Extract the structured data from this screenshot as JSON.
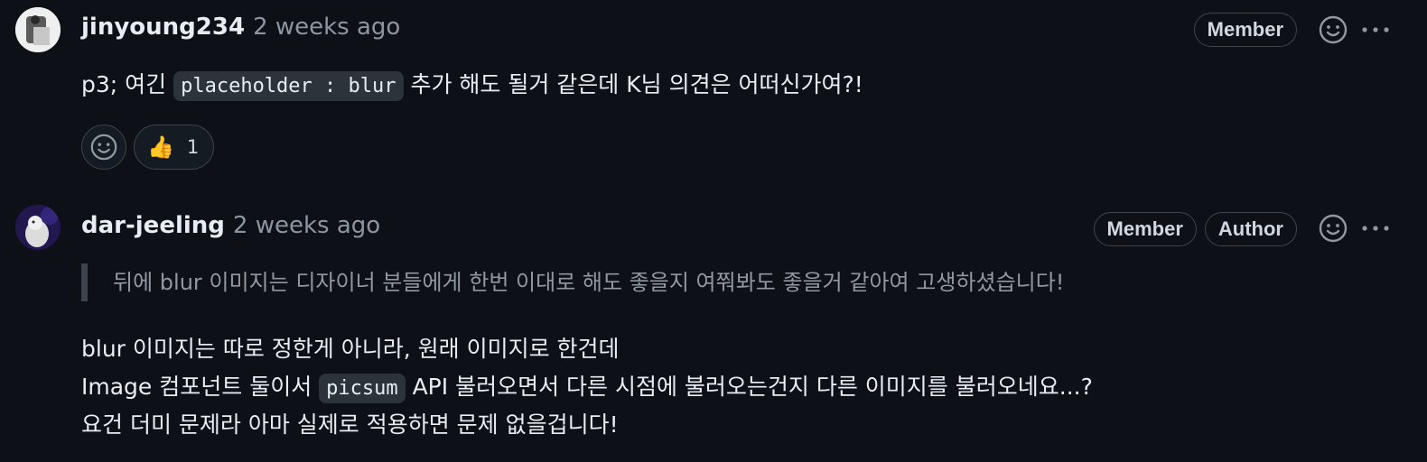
{
  "comments": [
    {
      "username": "jinyoung234",
      "timestamp": "2 weeks ago",
      "badges": [
        "Member"
      ],
      "body_prefix": "p3; 여긴 ",
      "body_code": "placeholder : blur",
      "body_suffix": " 추가 해도 될거 같은데 K님 의견은 어떠신가여?!",
      "reactions": [
        {
          "emoji": "👍",
          "count": "1"
        }
      ]
    },
    {
      "username": "dar-jeeling",
      "timestamp": "2 weeks ago",
      "badges": [
        "Member",
        "Author"
      ],
      "quote": "뒤에 blur 이미지는 디자이너 분들에게 한번 이대로 해도 좋을지 여쭤봐도 좋을거 같아여 고생하셨습니다!",
      "line1": "blur 이미지는 따로 정한게 아니라, 원래 이미지로 한건데",
      "line2_prefix": "Image 컴포넌트 둘이서 ",
      "line2_code": "picsum",
      "line2_suffix": " API 불러오면서 다른 시점에 불러오는건지 다른 이미지를 불러오네요...?",
      "line3": "요건 더미 문제라 아마 실제로 적용하면 문제 없을겁니다!"
    }
  ],
  "icons": {
    "add_reaction": "smiley-icon",
    "more": "kebab-horizontal-icon"
  }
}
